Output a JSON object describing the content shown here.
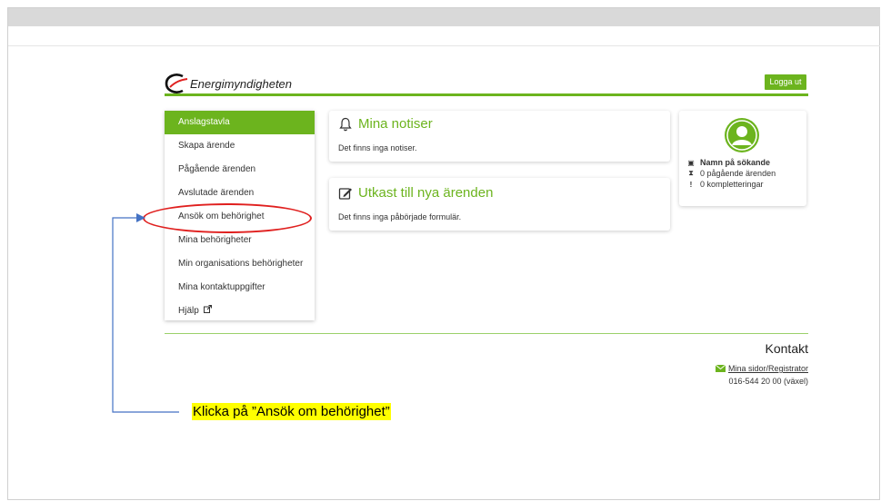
{
  "header": {
    "logo_text": "Energimyndigheten",
    "logout_label": "Logga ut"
  },
  "menu": {
    "items": [
      {
        "label": "Anslagstavla",
        "active": true
      },
      {
        "label": "Skapa ärende"
      },
      {
        "label": "Pågående ärenden"
      },
      {
        "label": "Avslutade ärenden"
      },
      {
        "label": "Ansök om behörighet"
      },
      {
        "label": "Mina behörigheter"
      },
      {
        "label": "Min organisations behörigheter"
      },
      {
        "label": "Mina kontaktuppgifter"
      },
      {
        "label": "Hjälp",
        "icon": "external-link-icon"
      }
    ]
  },
  "notices": {
    "title": "Mina notiser",
    "icon": "bell-icon",
    "text": "Det finns inga notiser."
  },
  "drafts": {
    "title": "Utkast till nya ärenden",
    "icon": "edit-icon",
    "text": "Det finns inga påbörjade formulär."
  },
  "profile": {
    "avatar_icon": "user-icon",
    "name": "Namn på sökande",
    "ongoing": "0 pågående ärenden",
    "completions": "0 kompletteringar"
  },
  "contact": {
    "title": "Kontakt",
    "link": "Mina sidor/Registrator",
    "phone": "016-544 20 00 (växel)"
  },
  "annotation": {
    "callout": "Klicka på ”Ansök om behörighet”"
  },
  "colors": {
    "brand_green": "#6cb41e",
    "highlight_red": "#e0201f",
    "arrow_blue": "#4472c4",
    "callout_yellow": "#ffff00"
  }
}
